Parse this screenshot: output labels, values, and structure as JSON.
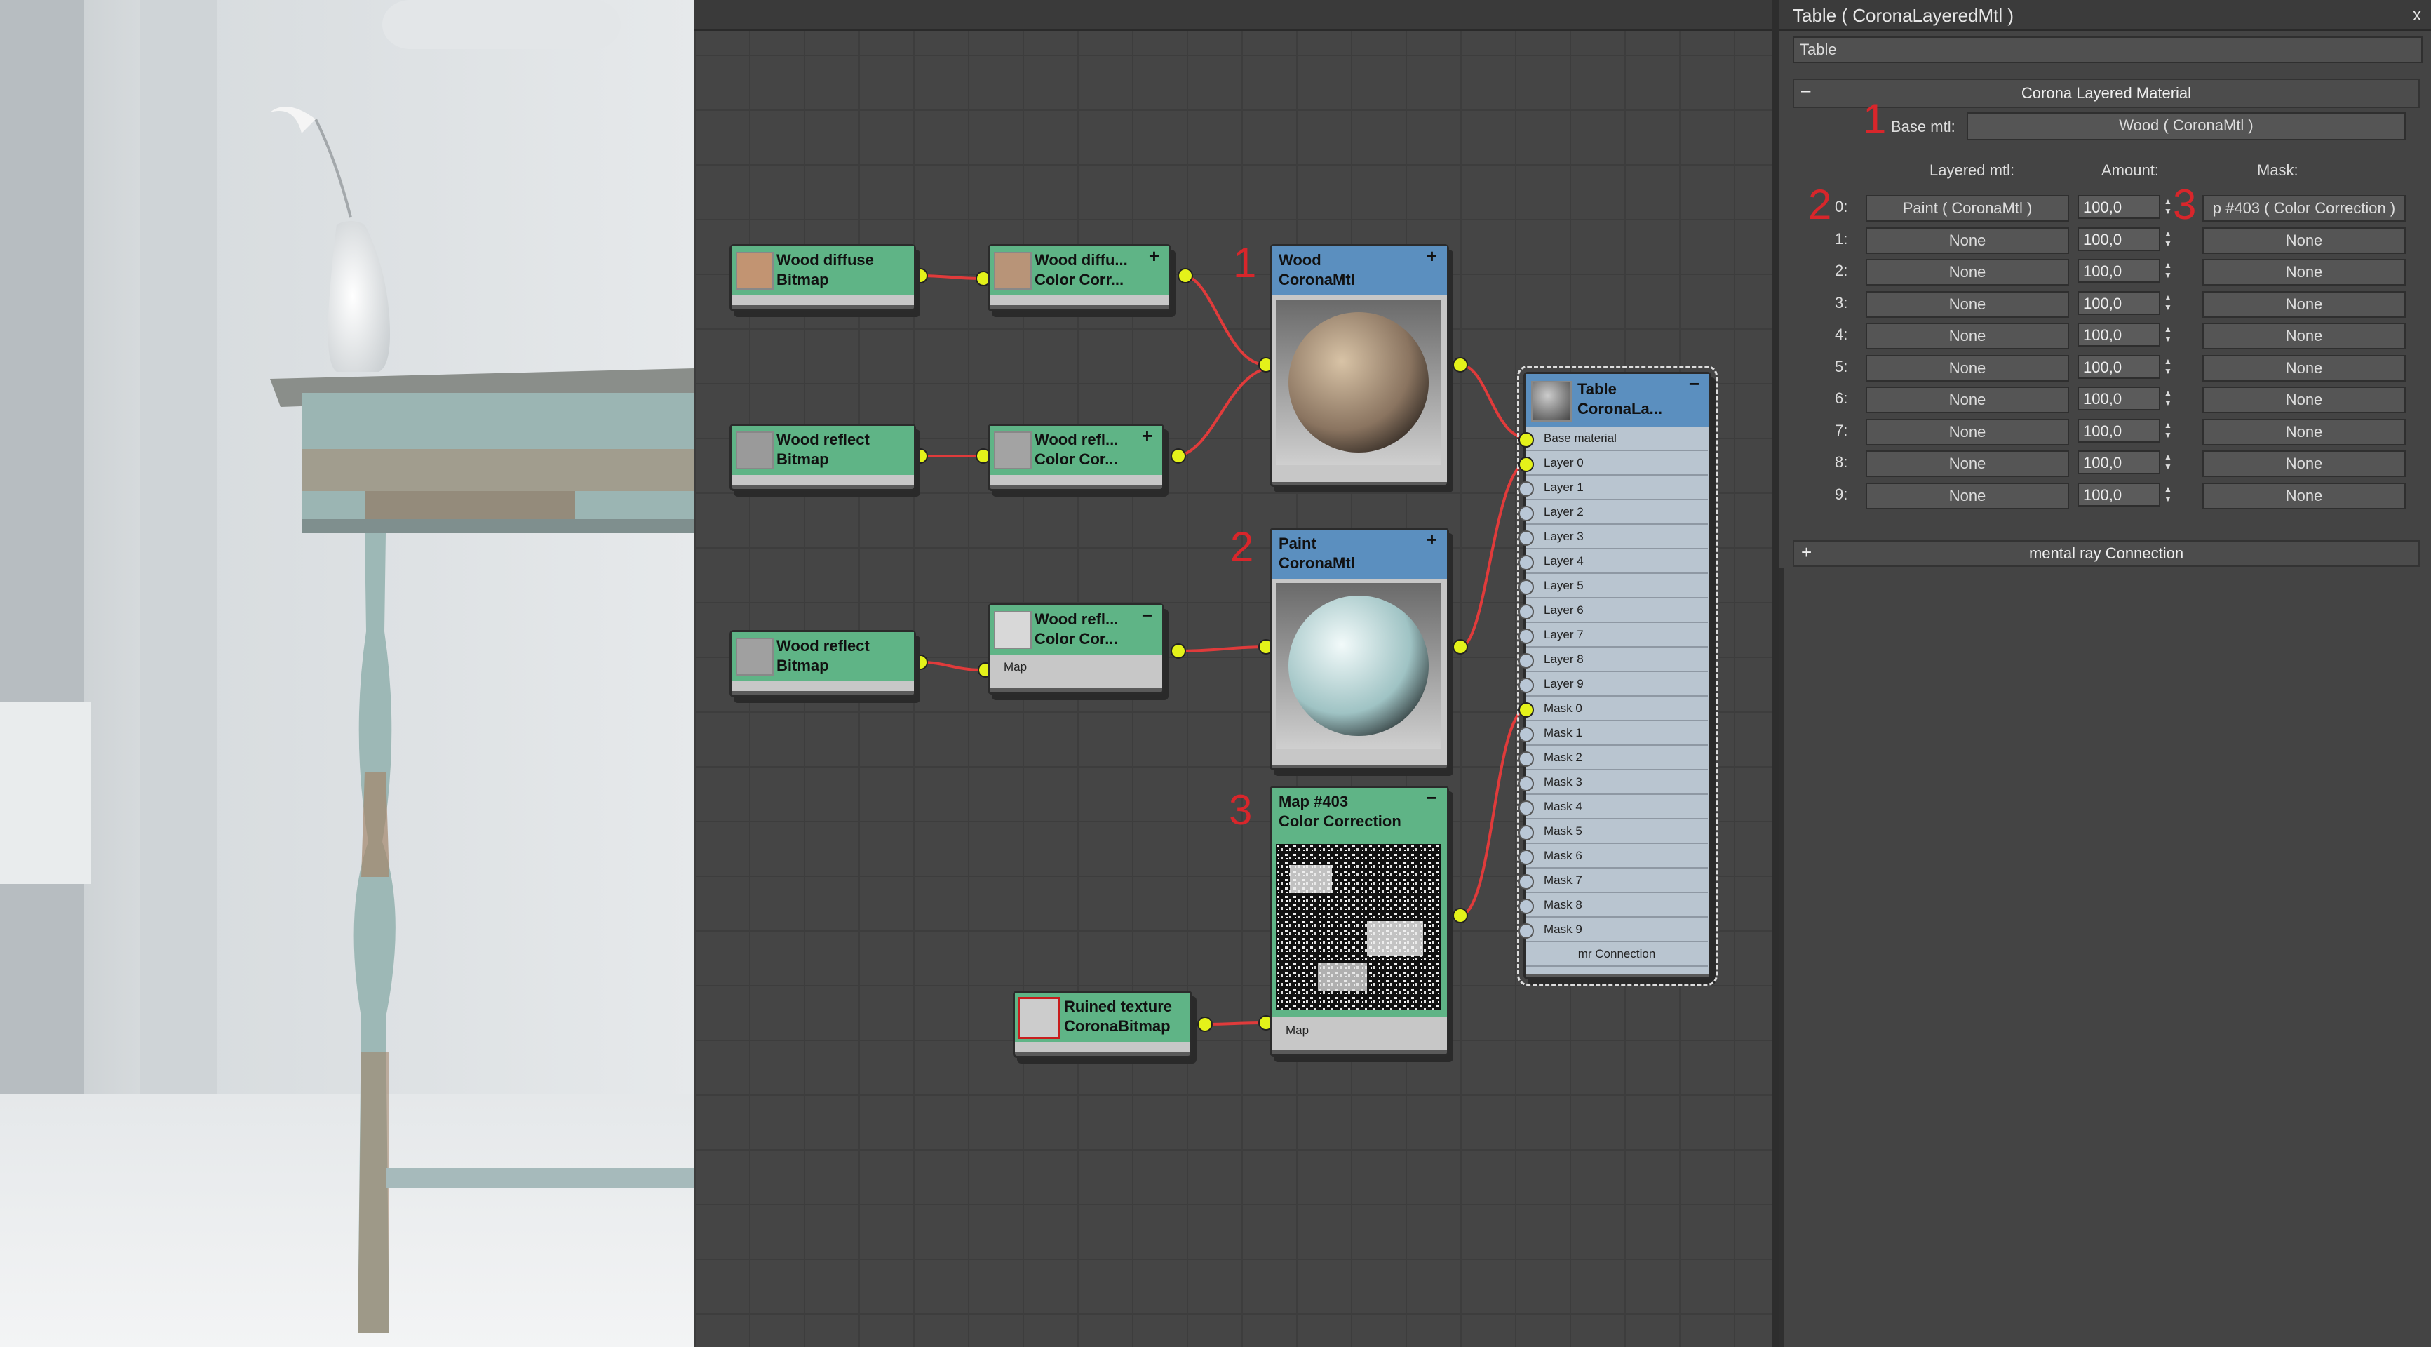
{
  "editor": {
    "nodes": {
      "wood_diffuse_bitmap": {
        "line1": "Wood diffuse",
        "line2": "Bitmap"
      },
      "wood_diffuse_cc": {
        "line1": "Wood  diffu...",
        "line2": "Color Corr...",
        "toggle": "+"
      },
      "wood_reflect_bitmap_1": {
        "line1": "Wood reflect",
        "line2": "Bitmap"
      },
      "wood_reflect_cc_1": {
        "line1": "Wood  refl...",
        "line2": "Color Cor...",
        "toggle": "+"
      },
      "wood_reflect_bitmap_2": {
        "line1": "Wood reflect",
        "line2": "Bitmap"
      },
      "wood_reflect_cc_2": {
        "line1": "Wood  refl...",
        "line2": "Color Cor...",
        "toggle": "−",
        "slot": "Map"
      },
      "wood_mtl": {
        "line1": "Wood",
        "line2": "CoronaMtl",
        "toggle": "+"
      },
      "paint_mtl": {
        "line1": "Paint",
        "line2": "CoronaMtl",
        "toggle": "+"
      },
      "map_403": {
        "line1": "Map #403",
        "line2": "Color Correction",
        "toggle": "−",
        "slot": "Map"
      },
      "ruined_texture": {
        "line1": "Ruined texture",
        "line2": "CoronaBitmap"
      },
      "table_layered": {
        "line1": "Table",
        "line2": "CoronaLa...",
        "toggle": "−",
        "slots": [
          "Base material",
          "Layer 0",
          "Layer 1",
          "Layer 2",
          "Layer 3",
          "Layer 4",
          "Layer 5",
          "Layer 6",
          "Layer 7",
          "Layer 8",
          "Layer 9",
          "Mask 0",
          "Mask 1",
          "Mask 2",
          "Mask 3",
          "Mask 4",
          "Mask 5",
          "Mask 6",
          "Mask 7",
          "Mask 8",
          "Mask 9"
        ],
        "footer": "mr Connection"
      }
    },
    "tags": {
      "one": "1",
      "two": "2",
      "three": "3"
    }
  },
  "panel": {
    "title": "Table  ( CoronaLayeredMtl )",
    "close": "x",
    "name_field": "Table",
    "rollout_title": "Corona Layered Material",
    "rollout_toggle": "–",
    "base_label": "Base mtl:",
    "base_value": "Wood  ( CoronaMtl )",
    "col_layered": "Layered mtl:",
    "col_amount": "Amount:",
    "col_mask": "Mask:",
    "rows": [
      {
        "idx": "0:",
        "mtl": "Paint  ( CoronaMtl )",
        "amount": "100,0",
        "mask": "p #403  ( Color Correction )"
      },
      {
        "idx": "1:",
        "mtl": "None",
        "amount": "100,0",
        "mask": "None"
      },
      {
        "idx": "2:",
        "mtl": "None",
        "amount": "100,0",
        "mask": "None"
      },
      {
        "idx": "3:",
        "mtl": "None",
        "amount": "100,0",
        "mask": "None"
      },
      {
        "idx": "4:",
        "mtl": "None",
        "amount": "100,0",
        "mask": "None"
      },
      {
        "idx": "5:",
        "mtl": "None",
        "amount": "100,0",
        "mask": "None"
      },
      {
        "idx": "6:",
        "mtl": "None",
        "amount": "100,0",
        "mask": "None"
      },
      {
        "idx": "7:",
        "mtl": "None",
        "amount": "100,0",
        "mask": "None"
      },
      {
        "idx": "8:",
        "mtl": "None",
        "amount": "100,0",
        "mask": "None"
      },
      {
        "idx": "9:",
        "mtl": "None",
        "amount": "100,0",
        "mask": "None"
      }
    ],
    "mr_toggle": "+",
    "mr_title": "mental ray Connection",
    "tags": {
      "one": "1",
      "two": "2",
      "three": "3"
    }
  },
  "colors": {
    "accent_red": "#d8262b",
    "node_green": "#5fb486",
    "node_blue": "#5b8fbf",
    "port_yellow": "#e4f21a"
  }
}
